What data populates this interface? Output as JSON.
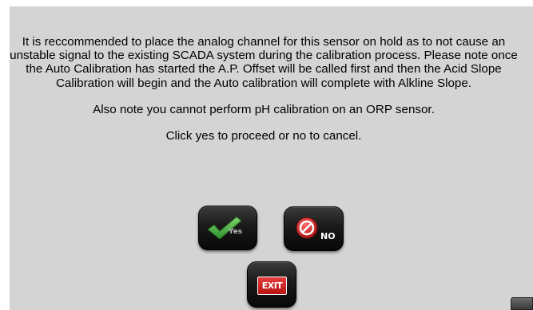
{
  "dialog": {
    "message": "It is reccommended to place the analog channel for this sensor on hold as to not cause an unstable signal to the existing SCADA system during the calibration process. Please note once the Auto Calibration has started the A.P. Offset will be called first and then the Acid Slope Calibration will begin and the Auto calibration will complete with Alkline Slope.",
    "note": "Also note you cannot perform pH calibration on an ORP sensor.",
    "prompt": "Click yes to proceed or no to cancel."
  },
  "buttons": {
    "yes_label": "Yes",
    "no_label": "NO",
    "exit_label": "EXIT"
  },
  "icons": {
    "yes": "checkmark-icon",
    "no": "no-entry-icon",
    "exit": "exit-icon",
    "corner": "back-icon"
  },
  "colors": {
    "panel_background": "#d4d4d4",
    "button_background": "#1a1a1a",
    "check_green": "#3aa73a",
    "no_red": "#d62828",
    "exit_red": "#d32020"
  }
}
